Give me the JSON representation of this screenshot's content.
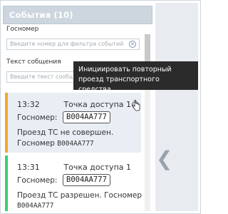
{
  "panel": {
    "title": "События (10)"
  },
  "filters": {
    "plate_label": "Госномер",
    "plate_placeholder": "Введите номер для фильтра событий",
    "message_label": "Текст собщения",
    "message_placeholder": "Введите текст сообщения",
    "clear_symbol": "✕"
  },
  "tooltip": {
    "text": "Инициировать повторный проезд транспортного средства"
  },
  "events": [
    {
      "time": "13:32",
      "point": "Точка доступа 1",
      "plate_label": "Госномер:",
      "plate": "В004АА777",
      "message_line1": "Проезд ТС не совершен.",
      "message_line2_label": "Госномер ",
      "message_line2_plate": "В004АА777",
      "status_color": "#f0a830"
    },
    {
      "time": "13:31",
      "point": "Точка доступа 1",
      "plate_label": "Госномер:",
      "plate": "В004АА777",
      "message_line1": "Проезд ТС разрешен. Госномер",
      "message_line2_plate": "В004АА777",
      "status_color": "#3ccf6a"
    }
  ],
  "side": {
    "collapse_glyph": "❮"
  },
  "colors": {
    "header_bg": "#cdd6df",
    "card_highlight_bg": "#e9eef5",
    "side_bg": "#e8ebef"
  }
}
